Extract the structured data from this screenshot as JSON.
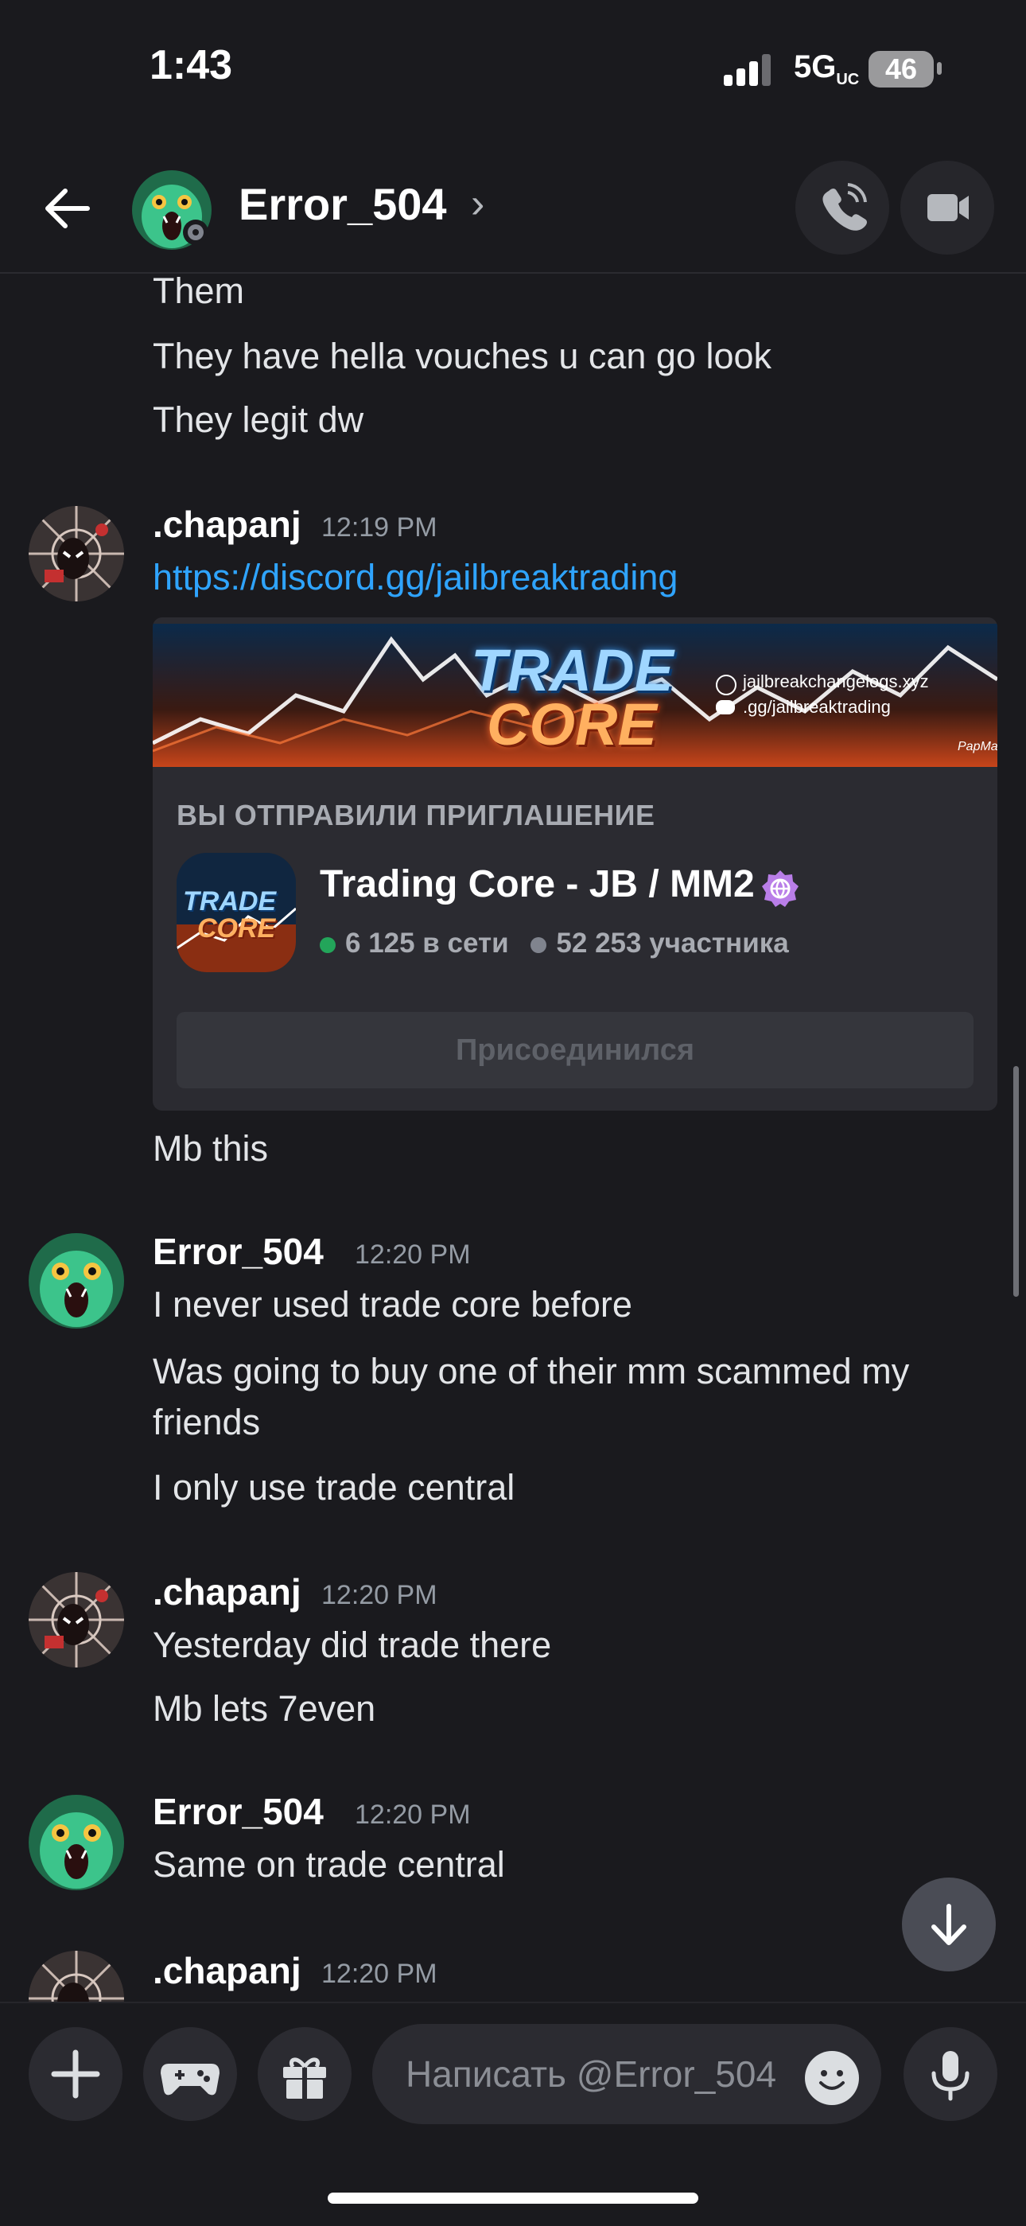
{
  "status_bar": {
    "time": "1:43",
    "network": "5G",
    "network_sub": "UC",
    "battery": "46"
  },
  "header": {
    "back_icon": "arrow-left-icon",
    "name": "Error_504",
    "chevron": "›",
    "call_icon": "phone-icon",
    "video_icon": "video-icon"
  },
  "messages": {
    "cont": [
      "Them",
      "They have hella vouches u can go look",
      "They legit dw"
    ],
    "g1": {
      "author": ".chapanj",
      "time": "12:19 PM",
      "link": "https://discord.gg/jailbreaktrading",
      "after": "Mb this"
    },
    "g2": {
      "author": "Error_504",
      "time": "12:20 PM",
      "lines": [
        "I never used trade core before",
        "Was going to buy one of their mm scammed my",
        "friends",
        "I only use trade central"
      ]
    },
    "g3": {
      "author": ".chapanj",
      "time": "12:20 PM",
      "lines": [
        "Yesterday did trade there",
        "Mb lets 7even"
      ]
    },
    "g4": {
      "author": "Error_504",
      "time": "12:20 PM",
      "lines": [
        "Same on trade central"
      ]
    },
    "g5": {
      "author": ".chapanj",
      "time": "12:20 PM"
    }
  },
  "invite": {
    "banner_title_1": "TRADE",
    "banner_title_2": "CORE",
    "banner_site": "jailbreakchangelogs.xyz",
    "banner_invite": ".gg/jailbreaktrading",
    "banner_sig": "PapMan",
    "label": "ВЫ ОТПРАВИЛИ ПРИГЛАШЕНИЕ",
    "icon_text_1": "TRADE",
    "icon_text_2": "CORE",
    "server_name": "Trading Core - JB / MM2",
    "online": "6 125 в сети",
    "members": "52 253 участника",
    "button": "Присоединился",
    "online_color": "#23a55a",
    "offline_color": "#80848e"
  },
  "composer": {
    "placeholder": "Написать @Error_504"
  },
  "colors": {
    "background": "#1a1a1e",
    "link": "#2fa4ff",
    "accent_badge": "#b97ee8"
  }
}
